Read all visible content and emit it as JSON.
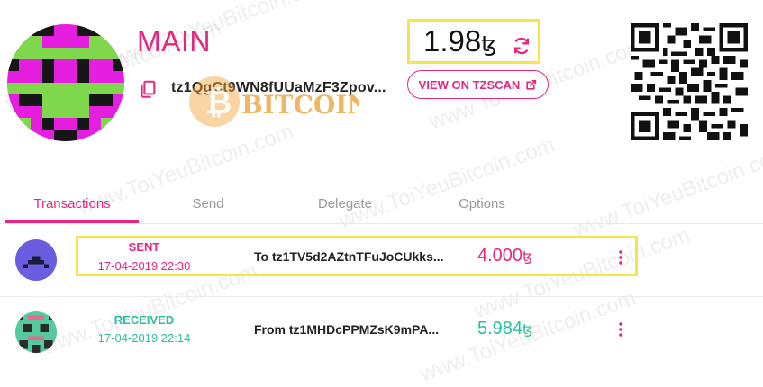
{
  "wallet": {
    "name": "MAIN",
    "address": "tz1QgCt9WN8fUUaMzF3Zpov...",
    "balance": "1.98",
    "currency_glyph": "ꜩ",
    "tzscan_label": "VIEW ON TZSCAN"
  },
  "watermark": {
    "site": "www.ToiYeuBitcoin.com",
    "logo_text": "BITCOIN"
  },
  "tabs": [
    {
      "label": "Transactions",
      "active": true
    },
    {
      "label": "Send",
      "active": false
    },
    {
      "label": "Delegate",
      "active": false
    },
    {
      "label": "Options",
      "active": false
    }
  ],
  "transactions": [
    {
      "type": "SENT",
      "date": "17-04-2019 22:30",
      "counterparty": "To tz1TV5d2AZtnTFuJoCUkks...",
      "amount": "4.000",
      "type_color": "#e6267f",
      "amount_color": "#e6267f"
    },
    {
      "type": "RECEIVED",
      "date": "17-04-2019 22:14",
      "counterparty": "From tz1MHDcPPMZsK9mPA...",
      "amount": "5.984",
      "type_color": "#2bbf9a",
      "amount_color": "#2bbf9a"
    }
  ],
  "colors": {
    "accent": "#e6267f",
    "received": "#2bbf9a",
    "highlight": "#f3e54a"
  }
}
